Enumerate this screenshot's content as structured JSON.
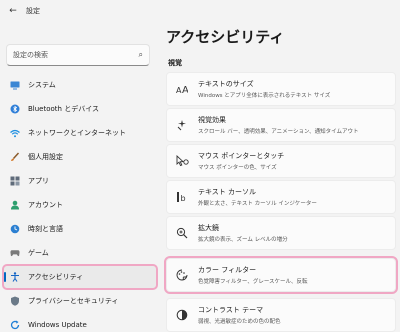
{
  "titlebar": {
    "back_icon": "back-arrow-icon",
    "title": "設定"
  },
  "search": {
    "placeholder": "設定の検索"
  },
  "sidebar": {
    "items": [
      {
        "label": "システム",
        "icon": "monitor-icon",
        "color": "#3a86d4"
      },
      {
        "label": "Bluetooth とデバイス",
        "icon": "bluetooth-icon",
        "color": "#2f7fd8"
      },
      {
        "label": "ネットワークとインターネット",
        "icon": "wifi-icon",
        "color": "#1f8fe0"
      },
      {
        "label": "個人用設定",
        "icon": "brush-icon",
        "color": "#d47a2a"
      },
      {
        "label": "アプリ",
        "icon": "apps-icon",
        "color": "#5f6b7a"
      },
      {
        "label": "アカウント",
        "icon": "account-icon",
        "color": "#2e9f6e"
      },
      {
        "label": "時刻と言語",
        "icon": "clock-globe-icon",
        "color": "#2b7fd1"
      },
      {
        "label": "ゲーム",
        "icon": "gamepad-icon",
        "color": "#7a7a7a"
      },
      {
        "label": "アクセシビリティ",
        "icon": "accessibility-icon",
        "color": "#1666c5",
        "active": true
      },
      {
        "label": "プライバシーとセキュリティ",
        "icon": "shield-icon",
        "color": "#6b7a88"
      },
      {
        "label": "Windows Update",
        "icon": "update-icon",
        "color": "#1f7fd6"
      }
    ]
  },
  "main": {
    "title": "アクセシビリティ",
    "section": "視覚",
    "cards": [
      {
        "title": "テキストのサイズ",
        "desc": "Windows とアプリ全体に表示されるテキスト サイズ",
        "icon": "text-size-icon"
      },
      {
        "title": "視覚効果",
        "desc": "スクロール バー、透明効果、アニメーション、通知タイムアウト",
        "icon": "visual-effects-icon"
      },
      {
        "title": "マウス ポインターとタッチ",
        "desc": "マウス ポインターの色、サイズ",
        "icon": "mouse-pointer-icon"
      },
      {
        "title": "テキスト カーソル",
        "desc": "外観と太さ、テキスト カーソル インジケーター",
        "icon": "text-cursor-icon"
      },
      {
        "title": "拡大鏡",
        "desc": "拡大鏡の表示、ズーム レベルの増分",
        "icon": "magnifier-icon"
      },
      {
        "title": "カラー フィルター",
        "desc": "色覚障害フィルター、グレースケール、反転",
        "icon": "color-filter-icon",
        "highlight": true
      },
      {
        "title": "コントラスト テーマ",
        "desc": "弱視、光過敏症のための色の配色",
        "icon": "contrast-icon"
      }
    ]
  },
  "colors": {
    "accent": "#0067c0",
    "highlight": "#f0a7c4"
  }
}
